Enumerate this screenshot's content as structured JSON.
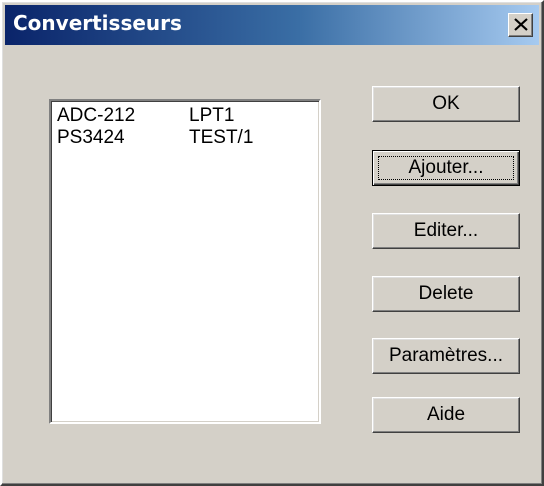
{
  "window": {
    "title": "Convertisseurs"
  },
  "list": {
    "rows": [
      {
        "name": "ADC-212",
        "port": "LPT1"
      },
      {
        "name": "PS3424",
        "port": "TEST/1"
      }
    ]
  },
  "buttons": {
    "ok": "OK",
    "add": "Ajouter...",
    "edit": "Editer...",
    "delete": "Delete",
    "params": "Paramètres...",
    "help": "Aide"
  },
  "icons": {
    "close": "close-icon"
  },
  "colors": {
    "titlebar_start": "#0a246a",
    "titlebar_end": "#a6caf0",
    "face": "#d4d0c8"
  }
}
